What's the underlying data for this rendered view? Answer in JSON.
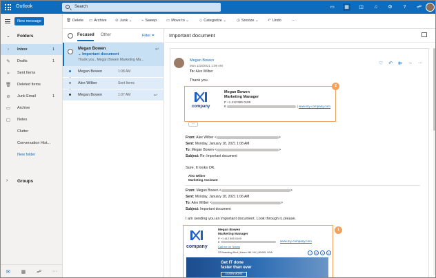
{
  "app": {
    "name": "Outlook"
  },
  "search": {
    "placeholder": "Search"
  },
  "left_rail": {
    "new_message": "New message",
    "folders_label": "Folders",
    "items": [
      {
        "label": "Inbox",
        "count": "1",
        "icon": "inbox-icon"
      },
      {
        "label": "Drafts",
        "count": "1",
        "icon": "pencil-icon"
      },
      {
        "label": "Sent Items",
        "count": "",
        "icon": "send-icon"
      },
      {
        "label": "Deleted Items",
        "count": "",
        "icon": "trash-icon"
      },
      {
        "label": "Junk Email",
        "count": "1",
        "icon": "junk-icon"
      },
      {
        "label": "Archive",
        "count": "",
        "icon": "archive-icon"
      },
      {
        "label": "Notes",
        "count": "",
        "icon": "note-icon"
      },
      {
        "label": "Clutter",
        "count": "",
        "icon": ""
      },
      {
        "label": "Conversation Hist...",
        "count": "",
        "icon": ""
      }
    ],
    "new_folder": "New folder",
    "groups_label": "Groups"
  },
  "toolbar": {
    "delete": "Delete",
    "archive": "Archive",
    "junk": "Junk",
    "sweep": "Sweep",
    "move_to": "Move to",
    "categorize": "Categorize",
    "snooze": "Snooze",
    "undo": "Undo",
    "more": "···"
  },
  "message_list": {
    "tab_focused": "Focused",
    "tab_other": "Other",
    "filter": "Filter",
    "selected": {
      "from": "Megan Bowen",
      "subject": "Important document",
      "preview": "Thank you.. Megan Bowen Marketing Ma..."
    },
    "thread": [
      {
        "name": "Megan Bowen",
        "meta": "1:08 AM"
      },
      {
        "name": "Alex Wilber",
        "meta": "Sent Items"
      },
      {
        "name": "Megan Bowen",
        "meta": "1:07 AM"
      }
    ]
  },
  "reading": {
    "subject": "Important document",
    "sender_name": "Megan Bowen",
    "sender_date": "Mon 1/18/2021 1:09 AM",
    "to_label": "To:",
    "to_value": "Alex Wilber",
    "body_thanks": "Thank you.",
    "sig2": {
      "badge": "2",
      "logo_word": "company",
      "name": "Megan Bowen",
      "title": "Marketing Manager",
      "phone": "P +1 412 555 0109",
      "email_prefix": "E",
      "separator": "|",
      "website": "www.my-company.com"
    },
    "quoted1": {
      "from_label": "From:",
      "from_value": "Alex Wilber <",
      "from_end": ">",
      "sent_label": "Sent:",
      "sent_value": "Monday, January 18, 2021 1:08 AM",
      "to_label": "To:",
      "to_value": "Megan Bowen <",
      "to_end": ">",
      "subject_label": "Subject:",
      "subject_value": "Re: Important document",
      "body": "Sure. It looks OK.",
      "sig_name": "Alex Wilber",
      "sig_title": "Marketing Assistant"
    },
    "quoted2": {
      "from_label": "From:",
      "from_value": "Megan Bowen <",
      "from_end": ">",
      "sent_label": "Sent:",
      "sent_value": "Monday, January 18, 2021 1:06 AM",
      "to_label": "To:",
      "to_value": "Alex Wilber <",
      "to_end": ">",
      "subject_label": "Subject:",
      "subject_value": "Important document",
      "body": "I am sending you an important document. Look through it, please."
    },
    "sig1": {
      "badge": "1",
      "logo_word": "company",
      "name": "Megan Bowen",
      "title": "Marketing Manager",
      "phone": "P +1 412 555 0109",
      "email_prefix": "E",
      "website": "www.my-company.com",
      "teams": "Call me on Teams",
      "address": "22 Branding Blvd | Azure Hill, NV | 80405, USA",
      "social": [
        "f",
        "in",
        "t",
        "p"
      ],
      "banner_line1": "Get IT done",
      "banner_line2": "faster than ever",
      "banner_button": "LEARN MORE"
    }
  }
}
